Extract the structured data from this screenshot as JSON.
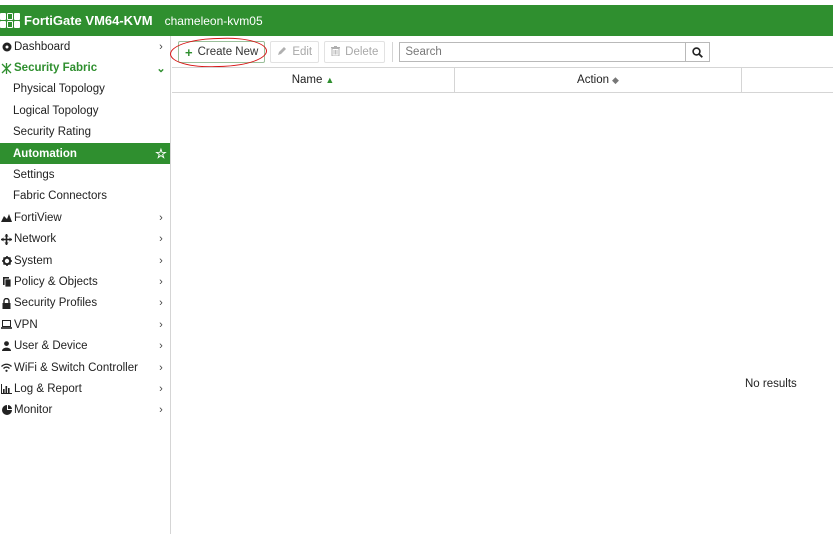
{
  "header": {
    "app_title": "FortiGate VM64-KVM",
    "hostname": "chameleon-kvm05",
    "accent_color": "#2f8f2f"
  },
  "sidebar": {
    "items": [
      {
        "label": "Dashboard",
        "icon": "dashboard-icon",
        "type": "top",
        "chevron": "›"
      },
      {
        "label": "Security Fabric",
        "icon": "security-fabric-icon",
        "type": "section",
        "chevron": "⌄"
      },
      {
        "label": "Physical Topology",
        "type": "sub"
      },
      {
        "label": "Logical Topology",
        "type": "sub"
      },
      {
        "label": "Security Rating",
        "type": "sub"
      },
      {
        "label": "Automation",
        "type": "active",
        "star": "☆"
      },
      {
        "label": "Settings",
        "type": "sub"
      },
      {
        "label": "Fabric Connectors",
        "type": "sub"
      },
      {
        "label": "FortiView",
        "icon": "fortiview-icon",
        "type": "top",
        "chevron": "›"
      },
      {
        "label": "Network",
        "icon": "network-icon",
        "type": "top",
        "chevron": "›"
      },
      {
        "label": "System",
        "icon": "gear-icon",
        "type": "top",
        "chevron": "›"
      },
      {
        "label": "Policy & Objects",
        "icon": "policy-icon",
        "type": "top",
        "chevron": "›"
      },
      {
        "label": "Security Profiles",
        "icon": "lock-icon",
        "type": "top",
        "chevron": "›"
      },
      {
        "label": "VPN",
        "icon": "laptop-icon",
        "type": "top",
        "chevron": "›"
      },
      {
        "label": "User & Device",
        "icon": "user-icon",
        "type": "top",
        "chevron": "›"
      },
      {
        "label": "WiFi & Switch Controller",
        "icon": "wifi-icon",
        "type": "top",
        "chevron": "›"
      },
      {
        "label": "Log & Report",
        "icon": "bar-chart-icon",
        "type": "top",
        "chevron": "›"
      },
      {
        "label": "Monitor",
        "icon": "pie-chart-icon",
        "type": "top",
        "chevron": "›"
      }
    ]
  },
  "toolbar": {
    "create_label": "Create New",
    "edit_label": "Edit",
    "delete_label": "Delete",
    "search_placeholder": "Search"
  },
  "table": {
    "columns": [
      "Name",
      "Action"
    ],
    "empty_text": "No results"
  }
}
